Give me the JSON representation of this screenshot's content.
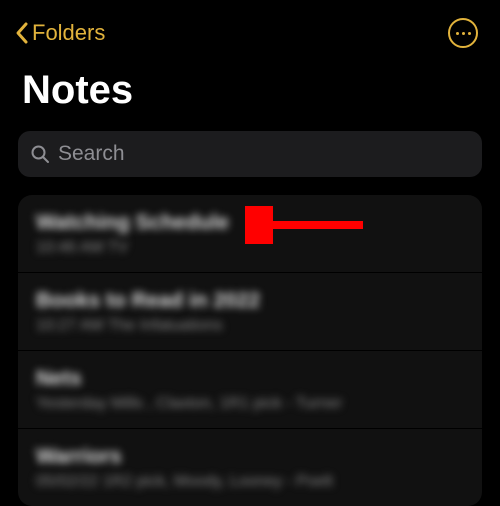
{
  "header": {
    "back_label": "Folders"
  },
  "title": "Notes",
  "search": {
    "placeholder": "Search"
  },
  "notes": [
    {
      "title": "Watching Schedule",
      "subtitle": "10:46 AM  TV"
    },
    {
      "title": "Books to Read in 2022",
      "subtitle": "10:27 AM  The Infatuations"
    },
    {
      "title": "Nets",
      "subtitle": "Yesterday  Mills , Claxton, 1R1 pick - Turner"
    },
    {
      "title": "Warriors",
      "subtitle": "05/02/22  1R2 pick, Moody, Looney - Poelt"
    }
  ],
  "accent_color": "#e2b33c",
  "annotation": {
    "arrow_color": "#ff0000"
  }
}
